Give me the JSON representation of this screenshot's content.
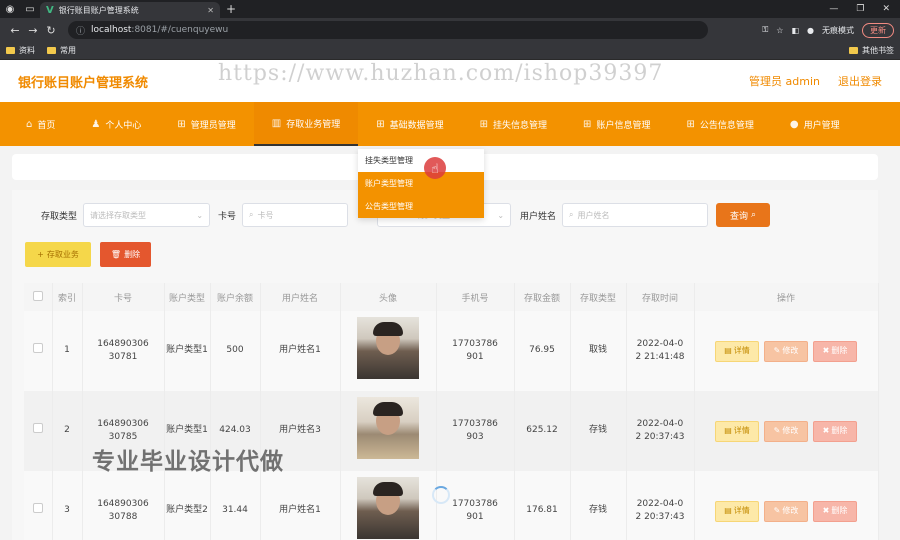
{
  "browser": {
    "tab_title": "银行账目账户管理系统",
    "url_host": "localhost",
    "url_rest": ":8081/#/cuenquyewu",
    "incognito": "无痕模式",
    "update": "更新",
    "bookmarks": [
      "资料",
      "常用"
    ],
    "bookmarks_right": "其他书签"
  },
  "header": {
    "title": "银行账目账户管理系统",
    "watermark": "https://www.huzhan.com/ishop39397",
    "user": "管理员 admin",
    "logout": "退出登录"
  },
  "menu": [
    {
      "label": "首页",
      "icon": "home-icon"
    },
    {
      "label": "个人中心",
      "icon": "user-icon"
    },
    {
      "label": "管理员管理",
      "icon": "grid-icon"
    },
    {
      "label": "存取业务管理",
      "icon": "bars-icon"
    },
    {
      "label": "基础数据管理",
      "icon": "grid-icon"
    },
    {
      "label": "挂失信息管理",
      "icon": "grid-icon"
    },
    {
      "label": "账户信息管理",
      "icon": "grid-icon"
    },
    {
      "label": "公告信息管理",
      "icon": "grid-icon"
    },
    {
      "label": "用户管理",
      "icon": "chat-icon"
    }
  ],
  "dropdown": [
    "挂失类型管理",
    "账户类型管理",
    "公告类型管理"
  ],
  "search": {
    "type_label": "存取类型",
    "type_placeholder": "请选择存取类型",
    "card_label": "卡号",
    "card_placeholder": "卡号",
    "account_type_placeholder": "账户类型",
    "name_label": "用户姓名",
    "name_placeholder": "用户姓名",
    "query": "查询"
  },
  "actions": {
    "add": "存取业务",
    "delete": "删除"
  },
  "table": {
    "headers": [
      "索引",
      "卡号",
      "账户类型",
      "账户余额",
      "用户姓名",
      "头像",
      "手机号",
      "存取金额",
      "存取类型",
      "存取时间",
      "操作"
    ],
    "ops": {
      "detail": "详情",
      "edit": "修改",
      "delete": "删除"
    },
    "rows": [
      {
        "index": "1",
        "card_a": "164890306",
        "card_b": "30781",
        "acct_type": "账户类型1",
        "balance": "500",
        "name": "用户姓名1",
        "phone_a": "17703786",
        "phone_b": "901",
        "amount": "76.95",
        "op_type": "取钱",
        "time_a": "2022-04-0",
        "time_b": "2 21:41:48"
      },
      {
        "index": "2",
        "card_a": "164890306",
        "card_b": "30785",
        "acct_type": "账户类型1",
        "balance": "424.03",
        "name": "用户姓名3",
        "phone_a": "17703786",
        "phone_b": "903",
        "amount": "625.12",
        "op_type": "存钱",
        "time_a": "2022-04-0",
        "time_b": "2 20:37:43"
      },
      {
        "index": "3",
        "card_a": "164890306",
        "card_b": "30788",
        "acct_type": "账户类型2",
        "balance": "31.44",
        "name": "用户姓名1",
        "phone_a": "17703786",
        "phone_b": "901",
        "amount": "176.81",
        "op_type": "存钱",
        "time_a": "2022-04-0",
        "time_b": "2 20:37:43"
      }
    ]
  },
  "promo": "专业毕业设计代做"
}
